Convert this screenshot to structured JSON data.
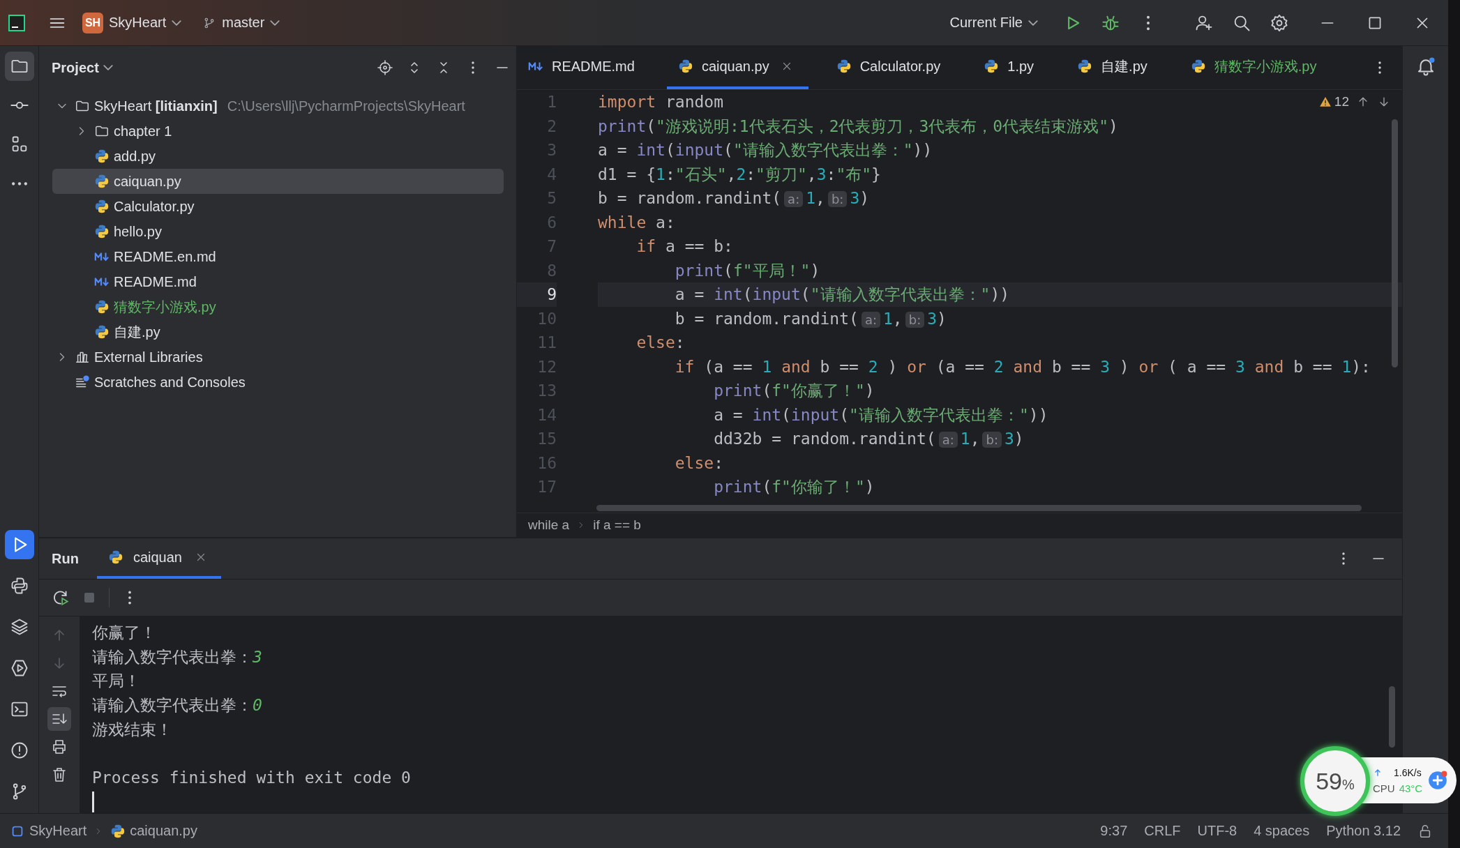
{
  "title_bar": {
    "project_badge": "SH",
    "project": "SkyHeart",
    "branch": "master",
    "run_config": "Current File"
  },
  "tool_strip_top": [
    {
      "kind": "project",
      "selected": true
    },
    {
      "kind": "commit",
      "selected": false
    },
    {
      "kind": "structure",
      "selected": false
    },
    {
      "kind": "more",
      "selected": false
    }
  ],
  "tool_strip_bottom": [
    {
      "kind": "run",
      "selected": true
    },
    {
      "kind": "python-console",
      "selected": false
    },
    {
      "kind": "packages",
      "selected": false
    },
    {
      "kind": "services",
      "selected": false
    },
    {
      "kind": "terminal",
      "selected": false
    },
    {
      "kind": "problems",
      "selected": false
    },
    {
      "kind": "git",
      "selected": false
    }
  ],
  "project_panel": {
    "title": "Project",
    "tree": [
      {
        "label": "SkyHeart **[litianxin]**",
        "path": "C:\\Users\\llj\\PycharmProjects\\SkyHeart",
        "kind": "folder",
        "expanded": true,
        "selected": false,
        "untracked": false,
        "children": [
          {
            "label": "chapter 1",
            "kind": "folder",
            "expanded": false,
            "selected": false,
            "untracked": false
          },
          {
            "label": "add.py",
            "kind": "python",
            "selected": false,
            "untracked": false
          },
          {
            "label": "caiquan.py",
            "kind": "python",
            "selected": true,
            "untracked": false
          },
          {
            "label": "Calculator.py",
            "kind": "python",
            "selected": false,
            "untracked": false
          },
          {
            "label": "hello.py",
            "kind": "python",
            "selected": false,
            "untracked": false
          },
          {
            "label": "README.en.md",
            "kind": "markdown",
            "selected": false,
            "untracked": false
          },
          {
            "label": "README.md",
            "kind": "markdown",
            "selected": false,
            "untracked": false
          },
          {
            "label": "猜数字小游戏.py",
            "kind": "python",
            "selected": false,
            "untracked": true
          },
          {
            "label": "自建.py",
            "kind": "python",
            "selected": false,
            "untracked": false
          }
        ]
      },
      {
        "label": "External Libraries",
        "kind": "libraries",
        "expanded": false,
        "selected": false,
        "untracked": false
      },
      {
        "label": "Scratches and Consoles",
        "kind": "scratches",
        "selected": false,
        "untracked": false
      }
    ]
  },
  "editor_tabs": [
    {
      "label": "README.md",
      "kind": "markdown",
      "selected": false,
      "untracked": false
    },
    {
      "label": "caiquan.py",
      "kind": "python",
      "selected": true,
      "untracked": false
    },
    {
      "label": "Calculator.py",
      "kind": "python",
      "selected": false,
      "untracked": false
    },
    {
      "label": "1.py",
      "kind": "python",
      "selected": false,
      "untracked": false
    },
    {
      "label": "自建.py",
      "kind": "python",
      "selected": false,
      "untracked": false
    },
    {
      "label": "猜数字小游戏.py",
      "kind": "python",
      "selected": false,
      "untracked": true
    }
  ],
  "editor": {
    "warnings": "12",
    "lines": [
      {
        "number": "1",
        "current": false,
        "tokens": [
          {
            "kind": "keyword",
            "text": "import"
          },
          {
            "kind": "plain",
            "text": " random"
          }
        ]
      },
      {
        "number": "2",
        "current": false,
        "tokens": [
          {
            "kind": "builtin",
            "text": "print"
          },
          {
            "kind": "plain",
            "text": "("
          },
          {
            "kind": "string",
            "text": "\"游戏说明:1代表石头，2代表剪刀，3代表布，0代表结束游戏\""
          },
          {
            "kind": "plain",
            "text": ")"
          }
        ]
      },
      {
        "number": "3",
        "current": false,
        "tokens": [
          {
            "kind": "plain",
            "text": "a = "
          },
          {
            "kind": "builtin",
            "text": "int"
          },
          {
            "kind": "plain",
            "text": "("
          },
          {
            "kind": "builtin",
            "text": "input"
          },
          {
            "kind": "plain",
            "text": "("
          },
          {
            "kind": "string",
            "text": "\"请输入数字代表出拳：\""
          },
          {
            "kind": "plain",
            "text": "))"
          }
        ]
      },
      {
        "number": "4",
        "current": false,
        "tokens": [
          {
            "kind": "plain",
            "text": "d1 = {"
          },
          {
            "kind": "number",
            "text": "1"
          },
          {
            "kind": "plain",
            "text": ":"
          },
          {
            "kind": "string",
            "text": "\"石头\""
          },
          {
            "kind": "plain",
            "text": ","
          },
          {
            "kind": "number",
            "text": "2"
          },
          {
            "kind": "plain",
            "text": ":"
          },
          {
            "kind": "string",
            "text": "\"剪刀\""
          },
          {
            "kind": "plain",
            "text": ","
          },
          {
            "kind": "number",
            "text": "3"
          },
          {
            "kind": "plain",
            "text": ":"
          },
          {
            "kind": "string",
            "text": "\"布\""
          },
          {
            "kind": "plain",
            "text": "}"
          }
        ]
      },
      {
        "number": "5",
        "current": false,
        "tokens": [
          {
            "kind": "plain",
            "text": "b = random.randint("
          },
          {
            "kind": "hint",
            "text": "a:"
          },
          {
            "kind": "number",
            "text": "1"
          },
          {
            "kind": "plain",
            "text": ","
          },
          {
            "kind": "hint",
            "text": "b:"
          },
          {
            "kind": "number",
            "text": "3"
          },
          {
            "kind": "plain",
            "text": ")"
          }
        ]
      },
      {
        "number": "6",
        "current": false,
        "tokens": [
          {
            "kind": "keyword",
            "text": "while"
          },
          {
            "kind": "plain",
            "text": " a:"
          }
        ]
      },
      {
        "number": "7",
        "current": false,
        "tokens": [
          {
            "kind": "keyword",
            "text": "    if"
          },
          {
            "kind": "plain",
            "text": " a == b:"
          }
        ]
      },
      {
        "number": "8",
        "current": false,
        "tokens": [
          {
            "kind": "builtin",
            "text": "        print"
          },
          {
            "kind": "plain",
            "text": "("
          },
          {
            "kind": "string",
            "text": "f\"平局！\""
          },
          {
            "kind": "plain",
            "text": ")"
          }
        ]
      },
      {
        "number": "9",
        "current": true,
        "tokens": [
          {
            "kind": "plain",
            "text": "        a = "
          },
          {
            "kind": "builtin",
            "text": "int"
          },
          {
            "kind": "plain",
            "text": "("
          },
          {
            "kind": "builtin",
            "text": "input"
          },
          {
            "kind": "plain",
            "text": "("
          },
          {
            "kind": "string",
            "text": "\"请输入数字代表出拳：\""
          },
          {
            "kind": "plain",
            "text": "))"
          }
        ]
      },
      {
        "number": "10",
        "current": false,
        "tokens": [
          {
            "kind": "plain",
            "text": "        b = random.randint("
          },
          {
            "kind": "hint",
            "text": "a:"
          },
          {
            "kind": "number",
            "text": "1"
          },
          {
            "kind": "plain",
            "text": ","
          },
          {
            "kind": "hint",
            "text": "b:"
          },
          {
            "kind": "number",
            "text": "3"
          },
          {
            "kind": "plain",
            "text": ")"
          }
        ]
      },
      {
        "number": "11",
        "current": false,
        "tokens": [
          {
            "kind": "keyword",
            "text": "    else"
          },
          {
            "kind": "plain",
            "text": ":"
          }
        ]
      },
      {
        "number": "12",
        "current": false,
        "tokens": [
          {
            "kind": "keyword",
            "text": "        if"
          },
          {
            "kind": "plain",
            "text": " (a == "
          },
          {
            "kind": "number",
            "text": "1"
          },
          {
            "kind": "keyword",
            "text": " and"
          },
          {
            "kind": "plain",
            "text": " b == "
          },
          {
            "kind": "number",
            "text": "2"
          },
          {
            "kind": "plain",
            "text": " ) "
          },
          {
            "kind": "keyword",
            "text": "or"
          },
          {
            "kind": "plain",
            "text": " (a == "
          },
          {
            "kind": "number",
            "text": "2"
          },
          {
            "kind": "keyword",
            "text": " and"
          },
          {
            "kind": "plain",
            "text": " b == "
          },
          {
            "kind": "number",
            "text": "3"
          },
          {
            "kind": "plain",
            "text": " ) "
          },
          {
            "kind": "keyword",
            "text": "or"
          },
          {
            "kind": "plain",
            "text": " ( a == "
          },
          {
            "kind": "number",
            "text": "3"
          },
          {
            "kind": "keyword",
            "text": " and"
          },
          {
            "kind": "plain",
            "text": " b == "
          },
          {
            "kind": "number",
            "text": "1"
          },
          {
            "kind": "plain",
            "text": "):"
          }
        ]
      },
      {
        "number": "13",
        "current": false,
        "tokens": [
          {
            "kind": "builtin",
            "text": "            print"
          },
          {
            "kind": "plain",
            "text": "("
          },
          {
            "kind": "string",
            "text": "f\"你赢了！\""
          },
          {
            "kind": "plain",
            "text": ")"
          }
        ]
      },
      {
        "number": "14",
        "current": false,
        "tokens": [
          {
            "kind": "plain",
            "text": "            a = "
          },
          {
            "kind": "builtin",
            "text": "int"
          },
          {
            "kind": "plain",
            "text": "("
          },
          {
            "kind": "builtin",
            "text": "input"
          },
          {
            "kind": "plain",
            "text": "("
          },
          {
            "kind": "string",
            "text": "\"请输入数字代表出拳：\""
          },
          {
            "kind": "plain",
            "text": "))"
          }
        ]
      },
      {
        "number": "15",
        "current": false,
        "tokens": [
          {
            "kind": "plain",
            "text": "            dd32b = random.randint("
          },
          {
            "kind": "hint",
            "text": "a:"
          },
          {
            "kind": "number",
            "text": "1"
          },
          {
            "kind": "plain",
            "text": ","
          },
          {
            "kind": "hint",
            "text": "b:"
          },
          {
            "kind": "number",
            "text": "3"
          },
          {
            "kind": "plain",
            "text": ")"
          }
        ]
      },
      {
        "number": "16",
        "current": false,
        "tokens": [
          {
            "kind": "keyword",
            "text": "        else"
          },
          {
            "kind": "plain",
            "text": ":"
          }
        ]
      },
      {
        "number": "17",
        "current": false,
        "tokens": [
          {
            "kind": "builtin",
            "text": "            print"
          },
          {
            "kind": "plain",
            "text": "("
          },
          {
            "kind": "string",
            "text": "f\"你输了！\""
          },
          {
            "kind": "plain",
            "text": ")"
          }
        ]
      }
    ],
    "breadcrumbs": [
      "while a",
      "if a == b"
    ]
  },
  "run_panel": {
    "title": "Run",
    "tabs": [
      {
        "label": "caiquan",
        "selected": true
      }
    ],
    "side_tools": [
      {
        "kind": "up",
        "selected": false
      },
      {
        "kind": "down",
        "selected": false
      },
      {
        "kind": "wrap",
        "selected": false
      },
      {
        "kind": "scroll-end",
        "selected": true
      },
      {
        "kind": "print",
        "selected": false
      },
      {
        "kind": "trash",
        "selected": false
      }
    ],
    "console": [
      {
        "kind": "output",
        "text": "你赢了！"
      },
      {
        "kind": "prompt",
        "text": "请输入数字代表出拳：",
        "input": "3"
      },
      {
        "kind": "output",
        "text": "平局！"
      },
      {
        "kind": "prompt",
        "text": "请输入数字代表出拳：",
        "input": "0"
      },
      {
        "kind": "output",
        "text": "游戏结束！"
      },
      {
        "kind": "exit",
        "text": "Process finished with exit code 0"
      }
    ]
  },
  "status_bar": {
    "breadcrumbs": [
      {
        "kind": "module",
        "text": "SkyHeart"
      },
      {
        "kind": "python",
        "text": "caiquan.py"
      }
    ],
    "items": [
      "9:37",
      "CRLF",
      "UTF-8",
      "4 spaces",
      "Python 3.12"
    ]
  },
  "monitor": {
    "load": "59",
    "unit": "%",
    "upload": "1.6K/s",
    "cpu_label": "CPU",
    "cpu_temp": "43°C"
  }
}
